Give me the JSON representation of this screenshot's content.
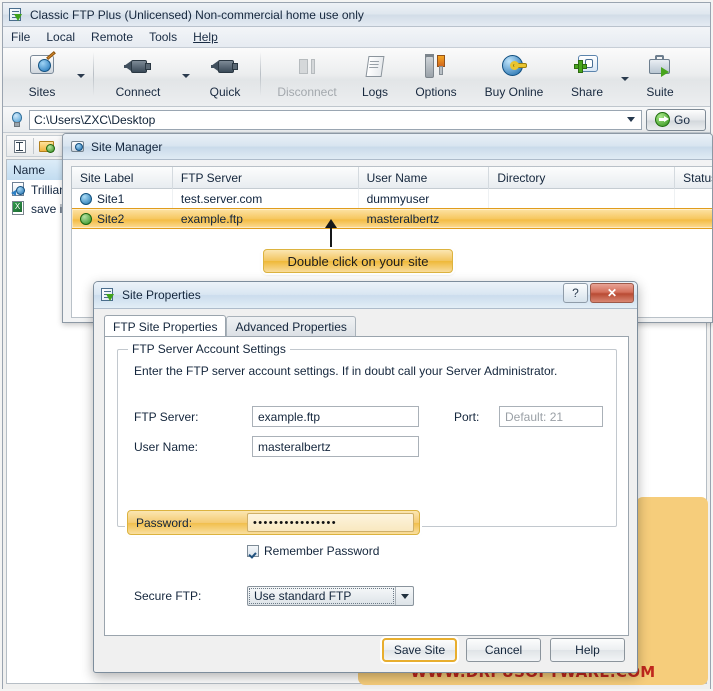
{
  "app": {
    "title": "Classic FTP Plus (Unlicensed) Non-commercial home use only",
    "icon": "ftp-app-icon"
  },
  "menu": {
    "items": [
      {
        "label": "File"
      },
      {
        "label": "Local"
      },
      {
        "label": "Remote"
      },
      {
        "label": "Tools"
      },
      {
        "label": "Help"
      }
    ]
  },
  "toolbar": {
    "buttons": [
      {
        "label": "Sites",
        "icon": "sites-icon",
        "enabled": true,
        "has_caret": true
      },
      {
        "label": "Connect",
        "icon": "connect-plug-icon",
        "enabled": true,
        "has_caret": true
      },
      {
        "label": "Quick",
        "icon": "quick-plug-icon",
        "enabled": true,
        "has_caret": false
      },
      {
        "label": "Disconnect",
        "icon": "disconnect-icon",
        "enabled": false,
        "has_caret": false
      },
      {
        "label": "Logs",
        "icon": "logs-scroll-icon",
        "enabled": true,
        "has_caret": false
      },
      {
        "label": "Options",
        "icon": "options-tools-icon",
        "enabled": true,
        "has_caret": false
      },
      {
        "label": "Buy Online",
        "icon": "buy-online-globe-key-icon",
        "enabled": true,
        "has_caret": false
      },
      {
        "label": "Share",
        "icon": "share-icon",
        "enabled": true,
        "has_caret": true
      },
      {
        "label": "Suite",
        "icon": "suite-briefcase-icon",
        "enabled": true,
        "has_caret": false
      }
    ]
  },
  "address_bar": {
    "icon": "local-drive-icon",
    "path": "C:\\Users\\ZXC\\Desktop",
    "dropdown_icon": "chevron-down-icon",
    "go_label": "Go",
    "go_icon": "go-arrow-icon"
  },
  "local_pane": {
    "columns": [
      "Name"
    ],
    "files": [
      {
        "name": "Trillian",
        "icon": "shortcut-icon"
      },
      {
        "name": "save in",
        "icon": "excel-file-icon"
      }
    ]
  },
  "site_manager": {
    "title": "Site Manager",
    "icon": "site-manager-icon",
    "columns": [
      "Site Label",
      "FTP Server",
      "User Name",
      "Directory",
      "Status"
    ],
    "rows": [
      {
        "site_label": "Site1",
        "ftp_server": "test.server.com",
        "user_name": "dummyuser",
        "directory": "",
        "status": "",
        "selected": false
      },
      {
        "site_label": "Site2",
        "ftp_server": "example.ftp",
        "user_name": "masteralbertz",
        "directory": "",
        "status": "",
        "selected": true
      }
    ]
  },
  "callout": {
    "text": "Double click on your site"
  },
  "site_properties": {
    "title": "Site Properties",
    "icon": "site-properties-icon",
    "help_button": "?",
    "close_button": "✕",
    "tabs": [
      {
        "label": "FTP Site Properties",
        "active": true
      },
      {
        "label": "Advanced Properties",
        "active": false
      }
    ],
    "group_title": "FTP Server Account Settings",
    "hint": "Enter the FTP server account settings. If in doubt call your Server Administrator.",
    "fields": {
      "ftp_server_label": "FTP Server:",
      "ftp_server_value": "example.ftp",
      "port_label": "Port:",
      "port_placeholder": "Default: 21",
      "user_name_label": "User Name:",
      "user_name_value": "masteralbertz",
      "password_label": "Password:",
      "password_value": "••••••••••••••••",
      "remember_password_label": "Remember Password",
      "remember_password_checked": true,
      "secure_ftp_label": "Secure FTP:",
      "secure_ftp_value": "Use standard FTP"
    },
    "buttons": [
      {
        "label": "Save Site",
        "default": true
      },
      {
        "label": "Cancel",
        "default": false
      },
      {
        "label": "Help",
        "default": false
      }
    ]
  },
  "watermark": {
    "text": "WWW.DRPUSOFTWARE.COM"
  },
  "colors": {
    "highlight_orange": "#f3bb41",
    "callout_border": "#dcb33f",
    "watermark_red": "#c0271d",
    "card_orange": "#f6cd7b"
  }
}
